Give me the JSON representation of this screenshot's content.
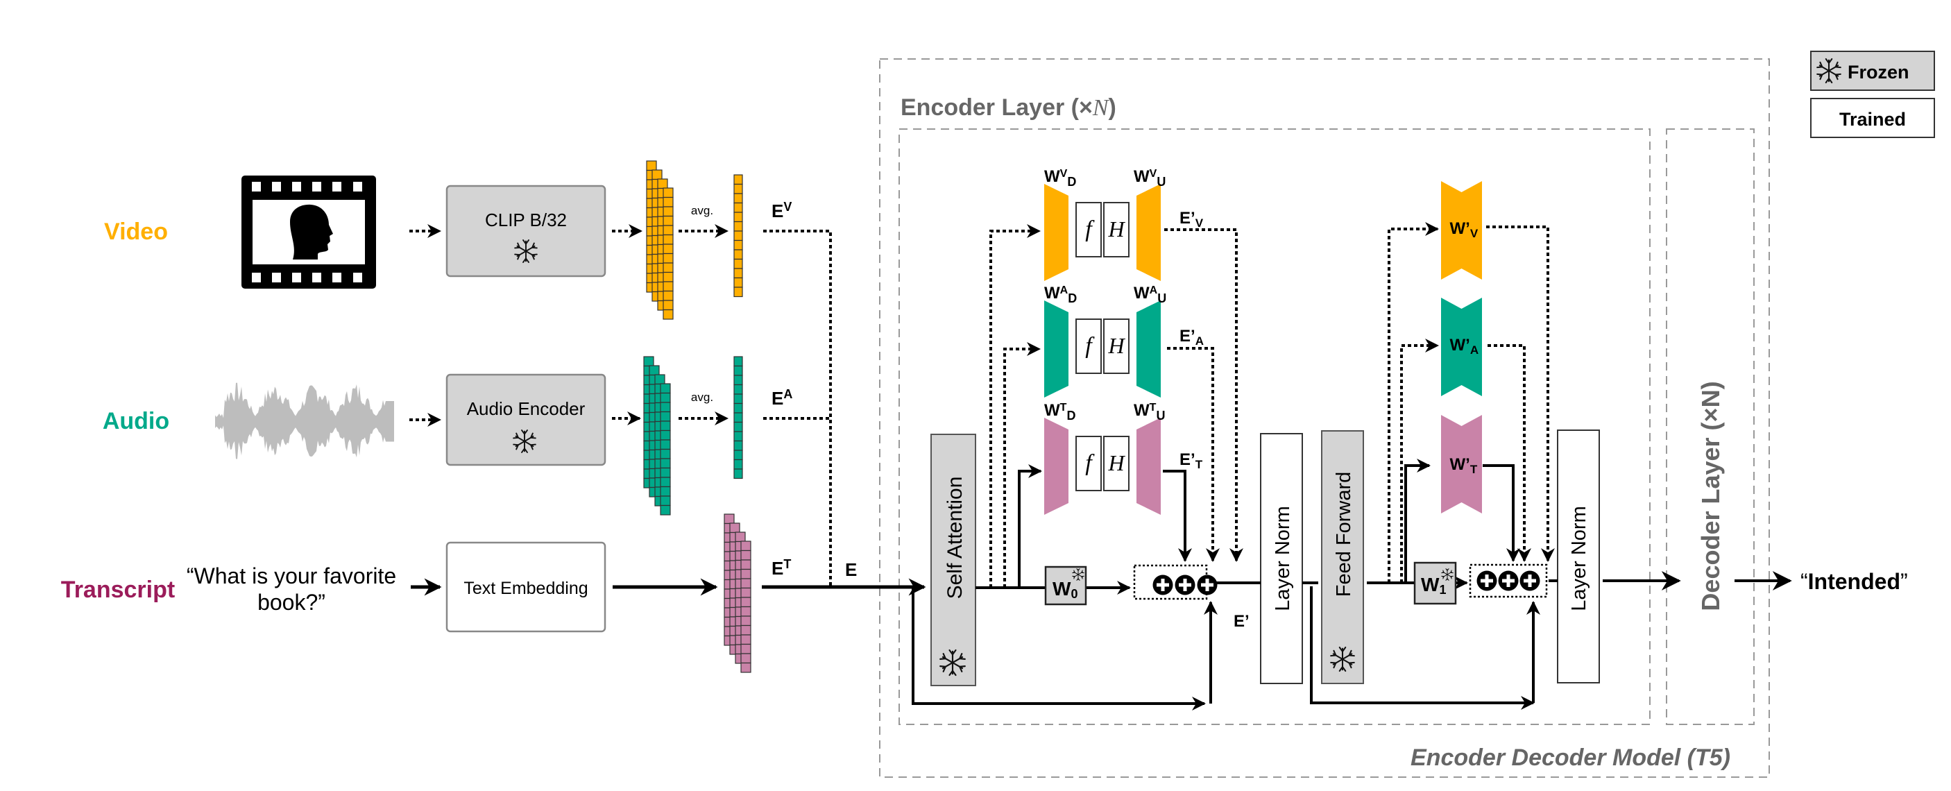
{
  "colors": {
    "video": "#FFAF00",
    "audio": "#00A98A",
    "text": "#C983A8",
    "transcript_label": "#9B1C5A",
    "frozen_fill": "#D4D4D4",
    "container_label": "#666666"
  },
  "legend": {
    "frozen": "Frozen",
    "trained": "Trained",
    "frozen_icon": "snowflake-icon"
  },
  "inputs": {
    "video": {
      "label": "Video",
      "icon": "film-strip-head-icon",
      "encoder": "CLIP B/32",
      "avg": "avg.",
      "emb": "E",
      "emb_sup": "V"
    },
    "audio": {
      "label": "Audio",
      "icon": "waveform-icon",
      "encoder": "Audio Encoder",
      "avg": "avg.",
      "emb": "E",
      "emb_sup": "A"
    },
    "transcript": {
      "label": "Transcript",
      "text_line1": "“What is your favorite",
      "text_line2": "book?”",
      "encoder": "Text Embedding",
      "emb": "E",
      "emb_sup": "T"
    }
  },
  "combined_emb": "E",
  "containers": {
    "outer": "Encoder Decoder Model (T5)",
    "encoder": "Encoder Layer (×",
    "encoder_n": "N",
    "encoder_close": ")",
    "decoder": "Decoder Layer (×N)"
  },
  "encoder": {
    "self_attention": "Self Attention",
    "layer_norm_1": "Layer Norm",
    "feed_forward": "Feed Forward",
    "layer_norm_2": "Layer Norm",
    "w0": {
      "main": "W",
      "sub": "0"
    },
    "w1": {
      "main": "W",
      "sub": "1"
    },
    "adapters": [
      {
        "mod": "V",
        "down": "W",
        "down_sup": "V",
        "down_sub": "D",
        "up": "W",
        "up_sup": "V",
        "up_sub": "U",
        "f": "f",
        "h": "H",
        "out": "E’",
        "out_sub": "V"
      },
      {
        "mod": "A",
        "down": "W",
        "down_sup": "A",
        "down_sub": "D",
        "up": "W",
        "up_sup": "A",
        "up_sub": "U",
        "f": "f",
        "h": "H",
        "out": "E’",
        "out_sub": "A"
      },
      {
        "mod": "T",
        "down": "W",
        "down_sup": "T",
        "down_sub": "D",
        "up": "W",
        "up_sup": "T",
        "up_sub": "U",
        "f": "f",
        "h": "H",
        "out": "E’",
        "out_sub": "T"
      }
    ],
    "ff_adapters": [
      {
        "label": "W’",
        "sub": "V"
      },
      {
        "label": "W’",
        "sub": "A"
      },
      {
        "label": "W’",
        "sub": "T"
      }
    ],
    "sum_label": "E’"
  },
  "output": {
    "open": "“",
    "word": "Intended",
    "close": "”"
  }
}
